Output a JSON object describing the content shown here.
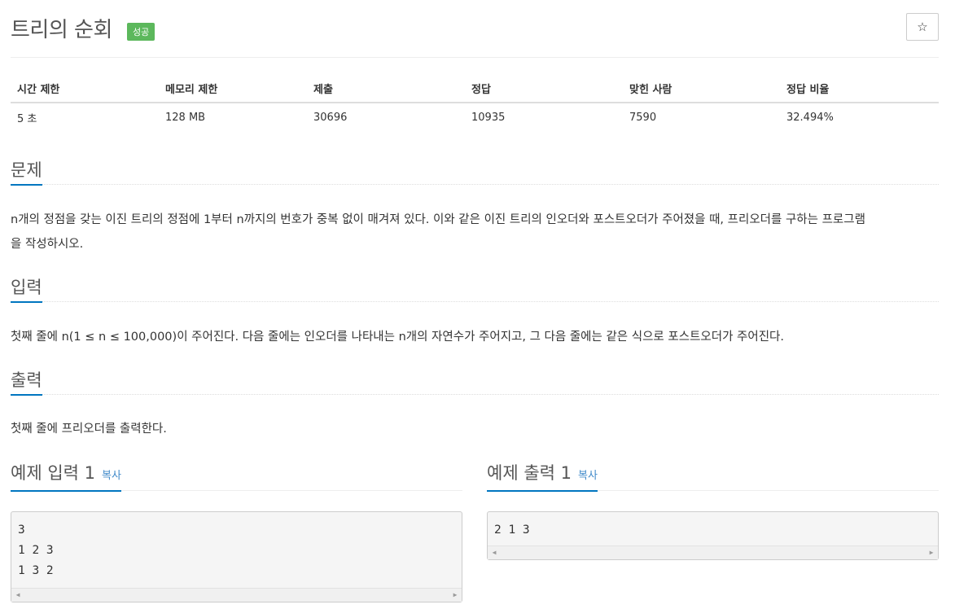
{
  "header": {
    "title": "트리의 순회",
    "badge": "성공",
    "star": "☆"
  },
  "info": {
    "columns": [
      "시간 제한",
      "메모리 제한",
      "제출",
      "정답",
      "맞힌 사람",
      "정답 비율"
    ],
    "values": [
      "5 초",
      "128 MB",
      "30696",
      "10935",
      "7590",
      "32.494%"
    ]
  },
  "sections": {
    "problem": {
      "title": "문제",
      "text_1": "n개의 정점을 갖는 이진 트리의 정점에 1부터 n까지의 번호가 중복 없이 매겨져 있다. 이와 같은 이진 트리의 인오더와 포스트오더가 주어졌을 때, 프리오더를 구하는 프로그램",
      "text_2": "을 작성하시오."
    },
    "input": {
      "title": "입력",
      "text": "첫째 줄에 n(1 ≤ n ≤ 100,000)이 주어진다. 다음 줄에는 인오더를 나타내는 n개의 자연수가 주어지고, 그 다음 줄에는 같은 식으로 포스트오더가 주어진다."
    },
    "output": {
      "title": "출력",
      "text": "첫째 줄에 프리오더를 출력한다."
    }
  },
  "samples": {
    "input": {
      "title": "예제 입력 1",
      "copy": "복사",
      "lines": [
        "3",
        "1 2 3",
        "1 3 2"
      ]
    },
    "output": {
      "title": "예제 출력 1",
      "copy": "복사",
      "lines": [
        "2 1 3"
      ]
    }
  },
  "scroll": {
    "left": "◀",
    "right": "▶"
  }
}
